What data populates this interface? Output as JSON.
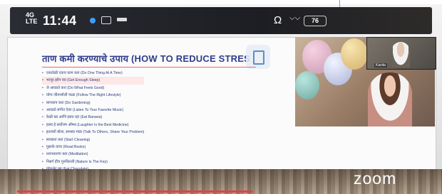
{
  "status_bar": {
    "signal_text": "4G\nLTE",
    "time": "11:44",
    "battery": "76",
    "icons": [
      "signal-icon",
      "location-dot-icon",
      "message-icon",
      "notification-icon",
      "headphones-icon",
      "wifi-icon",
      "battery-icon"
    ]
  },
  "slide": {
    "title": "ताण कमी करण्याचे उपाय (HOW TO REDUCE STRES",
    "items": [
      "एकावेळी एकच काम करा (Do One Thing At A Time)",
      "भरपूर झोप घ्या (Get Enough Sleep)",
      "जे आवडते करा (Do What Feels Good)",
      "योग्य जीवनशैली पाळा (Follow The Right Lifestyle)",
      "बागकाम करा (Do Gardening)",
      "आवडते संगीत ऐका (Listen To Your Favorite Music)",
      "केळी खा आणि हसत रहा (Eat Banana)",
      "हास्य हे सर्वोत्तम औषध (Laughter Is the Best Medicine)",
      "इतरांशी बोला, समस्या मांडा (Talk To Others, Share Your Problem)",
      "स्वच्छता करा (Start Cleaning)",
      "पुस्तके वाचा (Read Books)",
      "ध्यानधारणा करा (Meditation)",
      "निसर्ग हीच गुरुकिल्ली (Nature Is The Key)",
      "चॉकलेट खा (Eat Chocolate)"
    ],
    "highlighted_index": 1
  },
  "video": {
    "participant_name": "Kavita",
    "brand": "zoom"
  },
  "colors": {
    "title": "#303c8c",
    "accent_red": "#d44444",
    "status_bg": "#1f2024"
  }
}
